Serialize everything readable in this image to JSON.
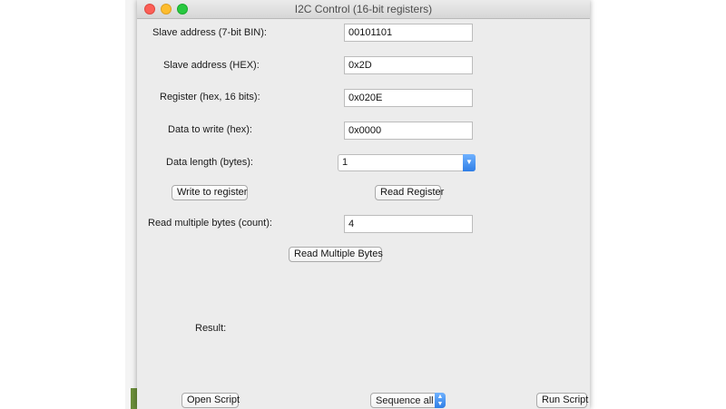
{
  "window": {
    "title": "I2C Control (16-bit registers)"
  },
  "form": {
    "slave_bin_label": "Slave address (7-bit BIN):",
    "slave_bin_value": "00101101",
    "slave_hex_label": "Slave address (HEX):",
    "slave_hex_value": "0x2D",
    "register_label": "Register (hex, 16 bits):",
    "register_value": "0x020E",
    "data_label": "Data to write (hex):",
    "data_value": "0x0000",
    "length_label": "Data length (bytes):",
    "length_value": "1",
    "count_label": "Read multiple bytes (count):",
    "count_value": "4",
    "result_label": "Result:"
  },
  "buttons": {
    "write": "Write to register",
    "read": "Read Register",
    "read_multiple": "Read Multiple Bytes",
    "open_script": "Open Script",
    "run_script": "Run Script"
  },
  "sequence": {
    "value": "Sequence all"
  },
  "colors": {
    "accent": "#3b86ee",
    "close": "#fc5f57",
    "minimize": "#fdbc2e",
    "zoom": "#28c840"
  }
}
